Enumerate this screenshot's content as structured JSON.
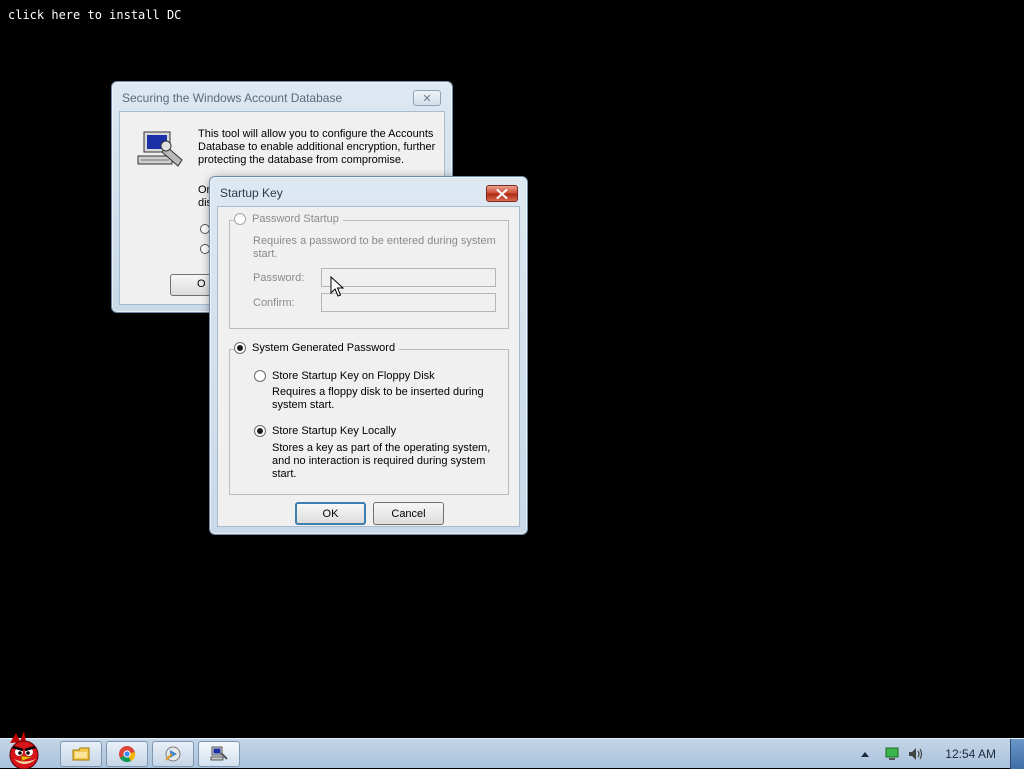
{
  "desktop": {
    "install_link": "click here to install DC"
  },
  "background_dialog": {
    "title": "Securing the Windows Account Database",
    "description": "This tool will allow you to configure the Accounts Database to enable additional encryption, further protecting the database from compromise.",
    "partial_text_line1": "Or",
    "partial_text_line2": "dis",
    "partial_button": "O"
  },
  "startup_key_dialog": {
    "title": "Startup Key",
    "password_startup": {
      "label": "Password Startup",
      "selected": false,
      "enabled": false,
      "description": "Requires a password to be entered during system start.",
      "password_label": "Password:",
      "password_value": "",
      "confirm_label": "Confirm:",
      "confirm_value": ""
    },
    "system_generated": {
      "label": "System Generated Password",
      "selected": true,
      "floppy": {
        "label": "Store Startup Key on Floppy Disk",
        "selected": false,
        "description": "Requires a floppy disk to be inserted during system start."
      },
      "locally": {
        "label": "Store Startup Key Locally",
        "selected": true,
        "description": "Stores a key as part of the operating system, and no interaction is required during system start."
      }
    },
    "ok_label": "OK",
    "cancel_label": "Cancel"
  },
  "taskbar": {
    "clock": "12:54 AM",
    "pinned": [
      "explorer-icon",
      "chrome-icon",
      "media-icon",
      "active-program-icon"
    ],
    "tray_icons": [
      "show-hidden-icons-arrow",
      "network-icon",
      "volume-icon"
    ]
  },
  "colors": {
    "desktop": "#000000",
    "close_button": "#c43c24",
    "default_button_border": "#3c7fb1"
  }
}
